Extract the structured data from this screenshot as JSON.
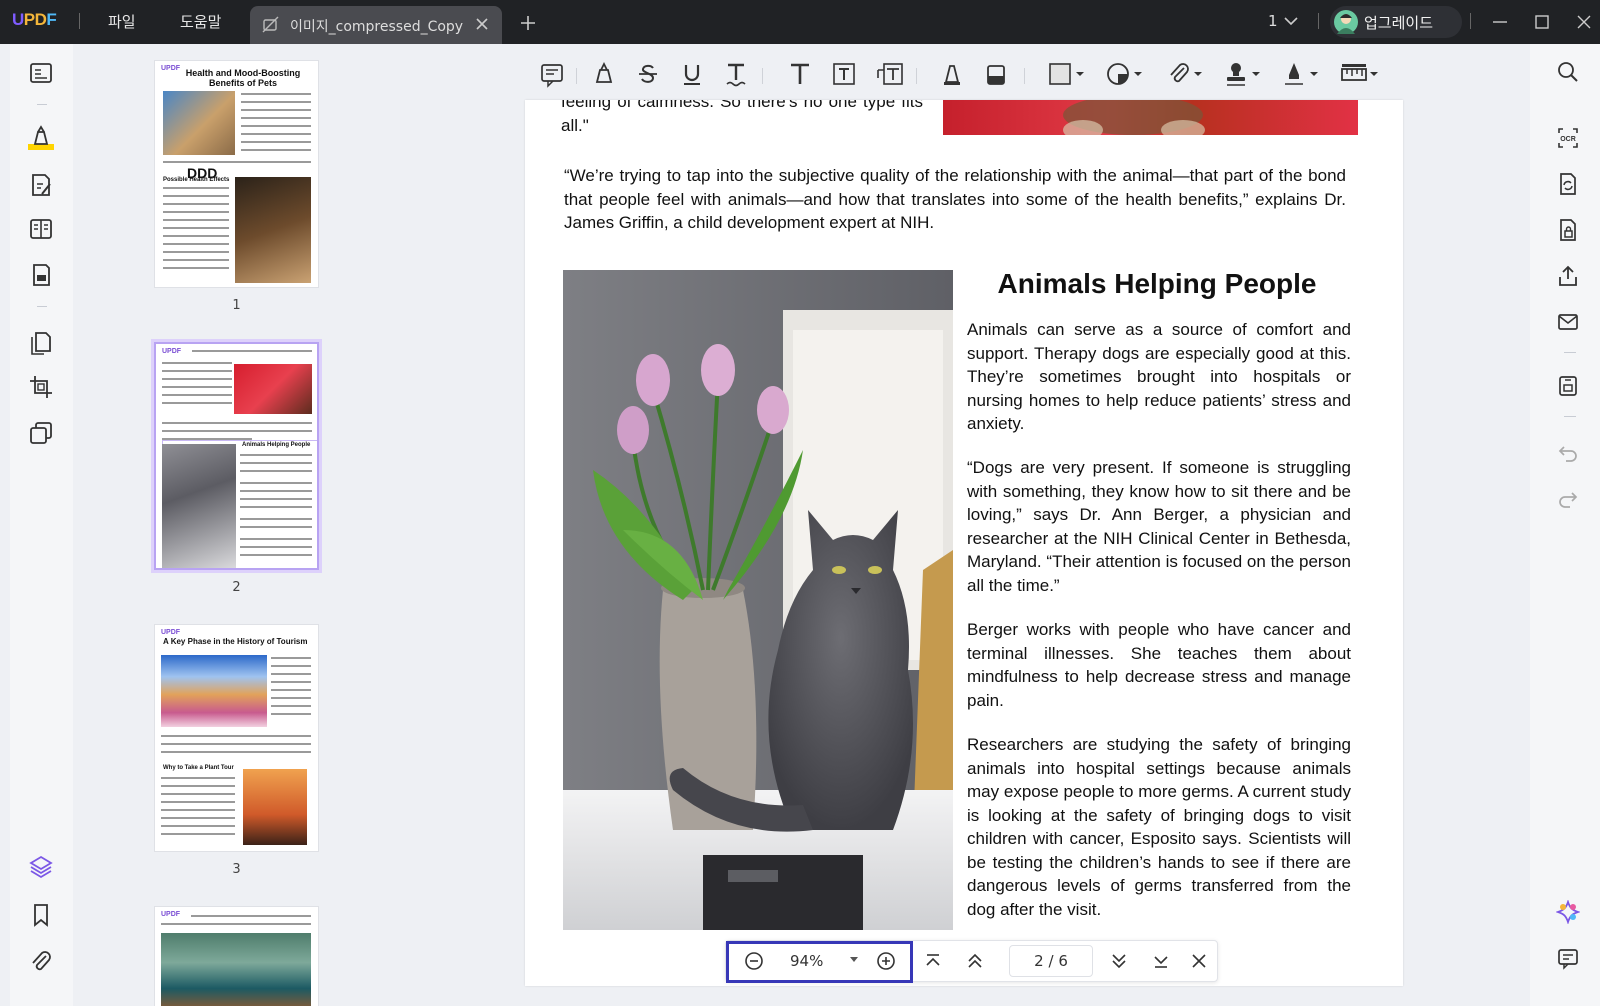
{
  "app": {
    "logo": "UPDF"
  },
  "menu": {
    "file": "파일",
    "help": "도움말"
  },
  "tab": {
    "title": "이미지_compressed_Copy"
  },
  "header": {
    "page_selector": "1",
    "upgrade_label": "업그레이드"
  },
  "thumbnails": [
    {
      "page_label": "1",
      "title": "Health and Mood-Boosting Benefits of Pets",
      "subhead": "Possible Health Effects",
      "stamp": "DDD"
    },
    {
      "page_label": "2",
      "title": "Animals Helping People"
    },
    {
      "page_label": "3",
      "title": "A Key Phase in the History of Tourism",
      "subhead": "Why to Take a Plant Tour"
    },
    {
      "page_label": ""
    }
  ],
  "document": {
    "top_fragment": "feeling of calmness. So there's no one type fits all.\"",
    "quote_paragraph": "“We’re trying to tap into the subjective quality of the relationship with the animal—that part of the bond that people feel with animals—and how that translates into some of the health benefits,” explains Dr. James Griffin, a child development expert at NIH.",
    "heading": "Animals Helping People",
    "paragraphs": [
      "Animals can serve as a source of comfort and support. Therapy dogs are especially good at this. They’re sometimes brought into hospitals or nursing homes to help reduce patients’ stress and anxiety.",
      "“Dogs are very present. If someone is struggling with something, they know how to sit there and be loving,” says Dr. Ann Berger, a physician and researcher at the NIH Clinical Center in Bethesda, Maryland. “Their attention is focused on the person all the time.”",
      "Berger works with people who have cancer and terminal illnesses. She teaches them about mindfulness to help decrease stress and manage pain.",
      "Researchers are studying the safety of bringing animals into hospital settings because animals may expose people to more germs. A current study is looking at the safety of bringing dogs to visit children with cancer, Esposito says. Scientists will be testing the children’s hands to see if there are dangerous levels of germs transferred from the dog after the visit."
    ]
  },
  "zoom": {
    "value": "94%"
  },
  "pagination": {
    "current": "2",
    "separator": "/",
    "total": "6"
  }
}
